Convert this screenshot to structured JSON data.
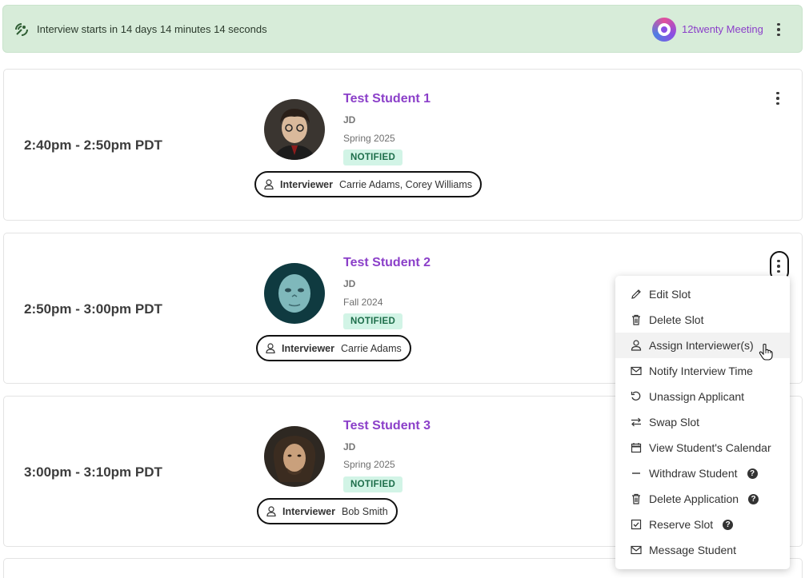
{
  "banner": {
    "countdown": "Interview starts in 14 days 14 minutes 14 seconds",
    "meeting_label": "12twenty Meeting",
    "icons": {
      "status": "satellite-signal-icon",
      "menu": "kebab-icon"
    }
  },
  "slots": [
    {
      "time": "2:40pm - 2:50pm PDT",
      "student_name": "Test Student 1",
      "initials": "JD",
      "term": "Spring 2025",
      "status": "NOTIFIED",
      "interviewer_label": "Interviewer",
      "interviewers": "Carrie Adams, Corey Williams"
    },
    {
      "time": "2:50pm - 3:00pm PDT",
      "student_name": "Test Student 2",
      "initials": "JD",
      "term": "Fall 2024",
      "status": "NOTIFIED",
      "interviewer_label": "Interviewer",
      "interviewers": "Carrie Adams"
    },
    {
      "time": "3:00pm - 3:10pm PDT",
      "student_name": "Test Student 3",
      "initials": "JD",
      "term": "Spring 2025",
      "status": "NOTIFIED",
      "interviewer_label": "Interviewer",
      "interviewers": "Bob Smith"
    }
  ],
  "menu": {
    "items": [
      {
        "label": "Edit Slot",
        "icon": "pencil-icon"
      },
      {
        "label": "Delete Slot",
        "icon": "trash-icon"
      },
      {
        "label": "Assign Interviewer(s)",
        "icon": "person-icon"
      },
      {
        "label": "Notify Interview Time",
        "icon": "envelope-icon"
      },
      {
        "label": "Unassign Applicant",
        "icon": "undo-icon"
      },
      {
        "label": "Swap Slot",
        "icon": "swap-icon"
      },
      {
        "label": "View Student's Calendar",
        "icon": "calendar-icon"
      },
      {
        "label": "Withdraw Student",
        "icon": "minus-icon"
      },
      {
        "label": "Delete Application",
        "icon": "trash-icon"
      },
      {
        "label": "Reserve Slot",
        "icon": "checkbox-icon"
      },
      {
        "label": "Message Student",
        "icon": "envelope-icon"
      }
    ],
    "help_glyph": "?"
  },
  "colors": {
    "accent": "#8b3fc9",
    "banner_bg": "#d7ecd9",
    "badge_bg": "#d2f4e6",
    "badge_text": "#1d6d4a"
  }
}
